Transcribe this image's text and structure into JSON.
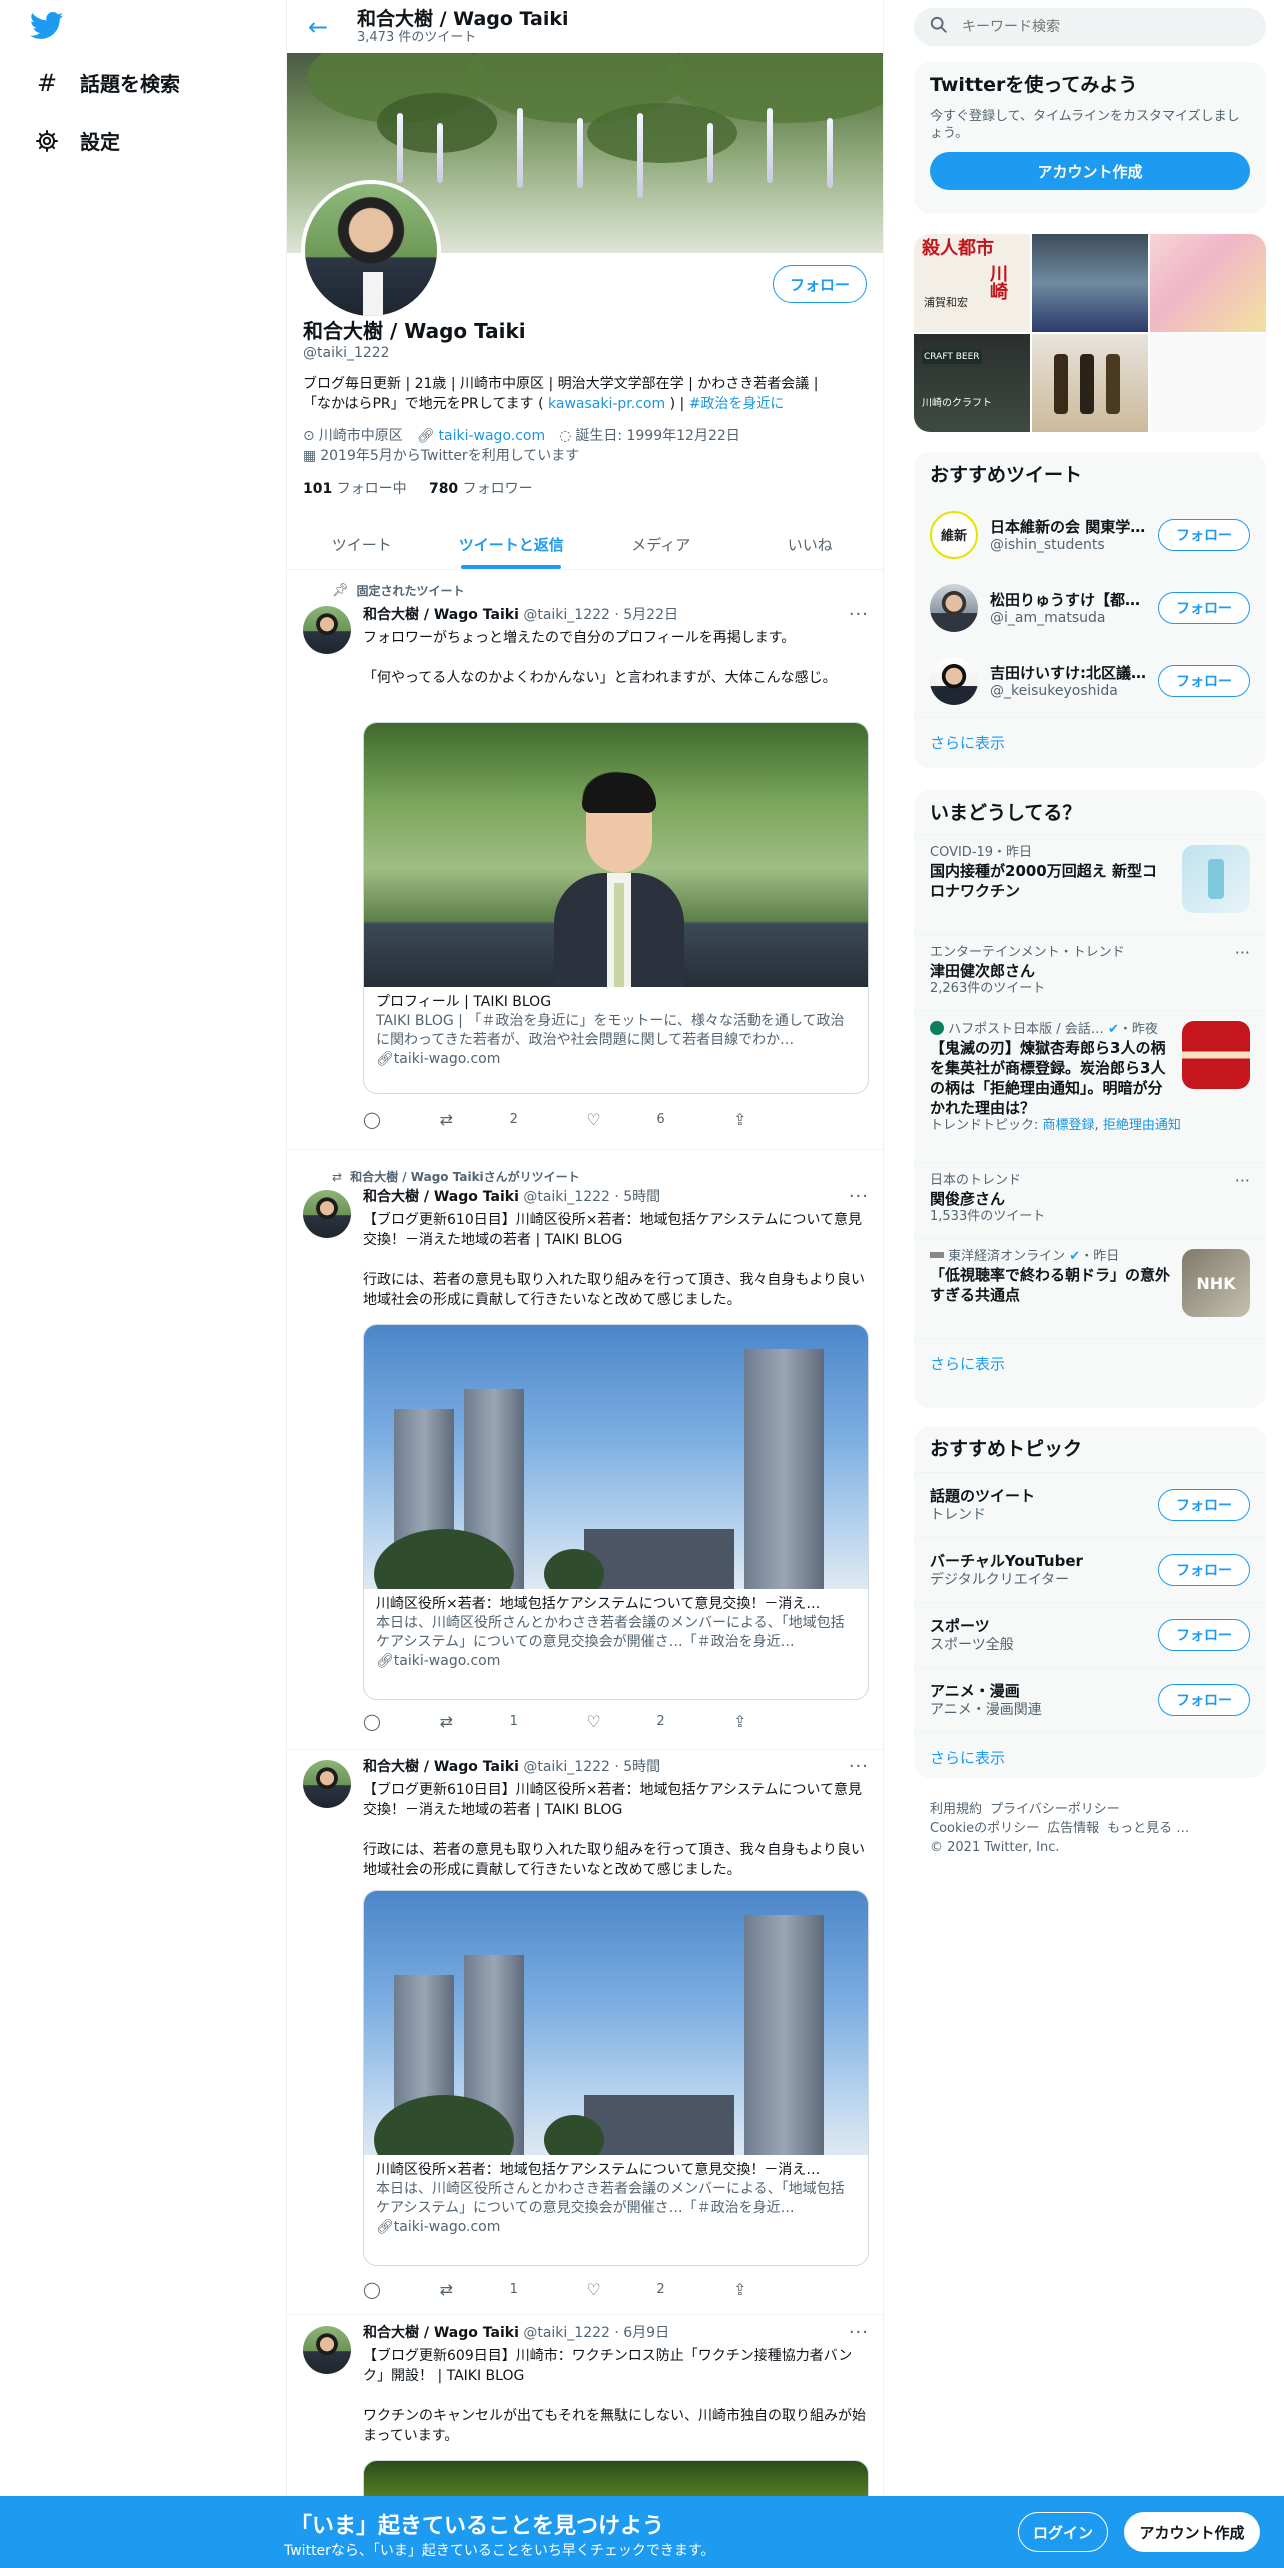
{
  "nav": {
    "explore": "話題を検索",
    "settings": "設定"
  },
  "header": {
    "name": "和合大樹 / Wago Taiki",
    "tweet_count": "3,473 件のツイート"
  },
  "profile": {
    "follow": "フォロー",
    "name": "和合大樹 / Wago Taiki",
    "handle": "@taiki_1222",
    "bio_1": "ブログ毎日更新 | 21歳 | 川崎市中原区 | 明治大学文学部在学 | かわさき若者会議 |",
    "bio_2a": "「なかはらPR」で地元をPRしてます (",
    "bio_link": "kawasaki-pr.com",
    "bio_2b": ") |",
    "bio_tag": "#政治を身近に",
    "location": "川崎市中原区",
    "website": "taiki-wago.com",
    "birthday": "誕生日: 1999年12月22日",
    "joined": "2019年5月からTwitterを利用しています",
    "following_count": "101",
    "following_label": "フォロー中",
    "followers_count": "780",
    "followers_label": "フォロワー"
  },
  "tabs": [
    "ツイート",
    "ツイートと返信",
    "メディア",
    "いいね"
  ],
  "tweets": [
    {
      "context": "固定されたツイート",
      "name": "和合大樹 / Wago Taiki",
      "meta": "@taiki_1222 · 5月22日",
      "text_1": "フォロワーがちょっと増えたので自分のプロフィールを再掲します。",
      "text_2": "「何やってる人なのかよくわかんない」と言われますが、大体こんな感じ。",
      "card_title": "プロフィール | TAIKI BLOG",
      "card_desc": "TAIKI BLOG | 「＃政治を身近に」をモットーに、様々な活動を通して政治に関わってきた若者が、政治や社会問題に関して若者目線でわか…",
      "card_url": "taiki-wago.com",
      "retweets": "2",
      "likes": "6"
    },
    {
      "context": "和合大樹 / Wago Taikiさんがリツイート",
      "name": "和合大樹 / Wago Taiki",
      "meta": "@taiki_1222 · 5時間",
      "text_1": "【ブログ更新610日目】川崎区役所×若者：地域包括ケアシステムについて意見交換！－消えた地域の若者 | TAIKI BLOG",
      "text_2": "行政には、若者の意見も取り入れた取り組みを行って頂き、我々自身もより良い地域社会の形成に貢献して行きたいなと改めて感じました。",
      "card_title": "川崎区役所×若者：地域包括ケアシステムについて意見交換！－消え…",
      "card_desc": "本日は、川崎区役所さんとかわさき若者会議のメンバーによる、「地域包括ケアシステム」についての意見交換会が開催さ…「＃政治を身近…",
      "card_url": "taiki-wago.com",
      "retweets": "1",
      "likes": "2"
    },
    {
      "name": "和合大樹 / Wago Taiki",
      "meta": "@taiki_1222 · 5時間",
      "text_1": "【ブログ更新610日目】川崎区役所×若者：地域包括ケアシステムについて意見交換！－消えた地域の若者 | TAIKI BLOG",
      "text_2": "行政には、若者の意見も取り入れた取り組みを行って頂き、我々自身もより良い地域社会の形成に貢献して行きたいなと改めて感じました。",
      "card_title": "川崎区役所×若者：地域包括ケアシステムについて意見交換！－消え…",
      "card_desc": "本日は、川崎区役所さんとかわさき若者会議のメンバーによる、「地域包括ケアシステム」についての意見交換会が開催さ…「＃政治を身近…",
      "card_url": "taiki-wago.com",
      "retweets": "1",
      "likes": "2"
    },
    {
      "name": "和合大樹 / Wago Taiki",
      "meta": "@taiki_1222 · 6月9日",
      "text_1": "【ブログ更新609日目】川崎市：ワクチンロス防止「ワクチン接種協力者バンク」開設！ | TAIKI BLOG",
      "text_2": "ワクチンのキャンセルが出てもそれを無駄にしない、川崎市独自の取り組みが始まっています。"
    }
  ],
  "search": {
    "placeholder": "キーワード検索"
  },
  "join": {
    "title": "Twitterを使ってみよう",
    "sub": "今すぐ登録して、タイムラインをカスタマイズしましょう。",
    "button": "アカウント作成"
  },
  "who_to_follow": {
    "title": "おすすめツイート",
    "users": [
      {
        "name": "日本維新の会 関東学…",
        "handle": "@ishin_students",
        "button": "フォロー",
        "avatar_text": "維新"
      },
      {
        "name": "松田りゅうすけ【都…",
        "handle": "@i_am_matsuda",
        "button": "フォロー"
      },
      {
        "name": "吉田けいすけ:北区議…",
        "handle": "@_keisukeyoshida",
        "button": "フォロー"
      }
    ],
    "more": "さらに表示"
  },
  "trends": {
    "title": "いまどうしてる？",
    "items": [
      {
        "context": "COVID-19・昨日",
        "title": "国内接種が2000万回超え 新型コロナワクチン"
      },
      {
        "context": "エンターテインメント・トレンド",
        "title": "津田健次郎さん",
        "count": "2,263件のツイート"
      },
      {
        "context": "ハフポスト日本版 / 会話…",
        "context_time": "・昨夜",
        "title": "【鬼滅の刃】煉獄杏寿郎ら3人の柄を集英社が商標登録。炭治郎ら3人の柄は「拒絶理由通知」。明暗が分かれた理由は？",
        "related_label": "トレンドトピック:",
        "related_1": "商標登録",
        "related_2": "拒絶理由通知"
      },
      {
        "context": "日本のトレンド",
        "title": "関俊彦さん",
        "count": "1,533件のツイート"
      },
      {
        "context": "東洋経済オンライン",
        "context_time": "・昨日",
        "title": "「低視聴率で終わる朝ドラ」の意外すぎる共通点"
      }
    ],
    "more": "さらに表示"
  },
  "topics": {
    "title": "おすすめトピック",
    "items": [
      {
        "name": "話題のツイート",
        "sub": "トレンド",
        "button": "フォロー"
      },
      {
        "name": "バーチャルYouTuber",
        "sub": "デジタルクリエイター",
        "button": "フォロー"
      },
      {
        "name": "スポーツ",
        "sub": "スポーツ全般",
        "button": "フォロー"
      },
      {
        "name": "アニメ・漫画",
        "sub": "アニメ・漫画関連",
        "button": "フォロー"
      }
    ],
    "more": "さらに表示"
  },
  "footer": {
    "terms": "利用規約",
    "privacy": "プライバシーポリシー",
    "cookie": "Cookieのポリシー",
    "ads": "広告情報",
    "more": "もっと見る …",
    "copyright": "© 2021 Twitter, Inc."
  },
  "bottom_bar": {
    "title": "「いま」起きていることを見つけよう",
    "sub": "Twitterなら、「いま」起きていることをいち早くチェックできます。",
    "login": "ログイン",
    "signup": "アカウント作成"
  },
  "grid_images": {
    "book_title_1": "殺人都市",
    "book_title_2": "川崎",
    "book_author": "浦賀和宏",
    "beer_label": "CRAFT BEER",
    "beer_caption": "川崎のクラフト"
  },
  "trend_thumb_text": "NHK",
  "colors": {
    "accent": "#1d9bf0",
    "text": "#0f1419",
    "secondary": "#536471",
    "panel": "#f7f9f9"
  }
}
